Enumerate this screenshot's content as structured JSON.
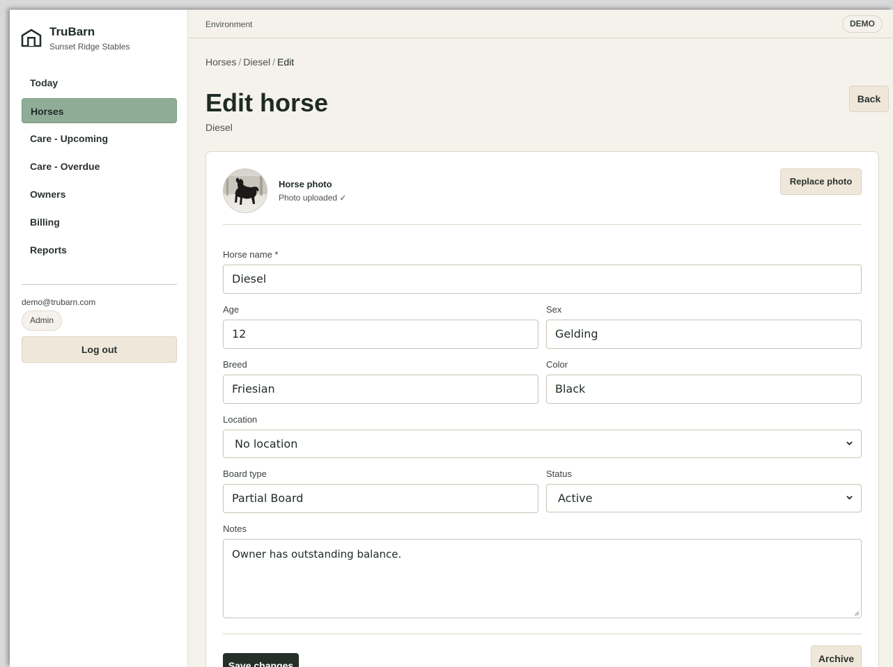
{
  "app": {
    "name": "TruBarn",
    "org": "Sunset Ridge Stables",
    "logo_icon": "barn-icon"
  },
  "sidebar": {
    "items": [
      {
        "label": "Today"
      },
      {
        "label": "Horses"
      },
      {
        "label": "Care - Upcoming"
      },
      {
        "label": "Care - Overdue"
      },
      {
        "label": "Owners"
      },
      {
        "label": "Billing"
      },
      {
        "label": "Reports"
      }
    ],
    "active": "Horses",
    "user_email": "demo@trubarn.com",
    "role": "Admin",
    "logout_label": "Log out"
  },
  "topbar": {
    "environment_label": "Environment",
    "environment_badge": "DEMO"
  },
  "breadcrumb": {
    "horses": "Horses",
    "horse": "Diesel",
    "current": "Edit",
    "separator": "/"
  },
  "page": {
    "title": "Edit horse",
    "subtitle": "Diesel",
    "back_label": "Back"
  },
  "photo": {
    "title": "Horse photo",
    "status": "Photo uploaded ✓",
    "replace_label": "Replace photo"
  },
  "form": {
    "name": {
      "label": "Horse name *",
      "value": "Diesel"
    },
    "age": {
      "label": "Age",
      "value": "12"
    },
    "sex": {
      "label": "Sex",
      "value": "Gelding"
    },
    "breed": {
      "label": "Breed",
      "value": "Friesian"
    },
    "color": {
      "label": "Color",
      "value": "Black"
    },
    "location": {
      "label": "Location",
      "value": "No location"
    },
    "board_type": {
      "label": "Board type",
      "value": "Partial Board"
    },
    "status": {
      "label": "Status",
      "value": "Active"
    },
    "notes": {
      "label": "Notes",
      "value": "Owner has outstanding balance."
    }
  },
  "actions": {
    "save_label": "Save changes",
    "archive_label": "Archive"
  },
  "colors": {
    "accent": "#8fad96",
    "primary_button": "#253028",
    "secondary_button": "#efe7da",
    "background": "#f5f2ec"
  }
}
